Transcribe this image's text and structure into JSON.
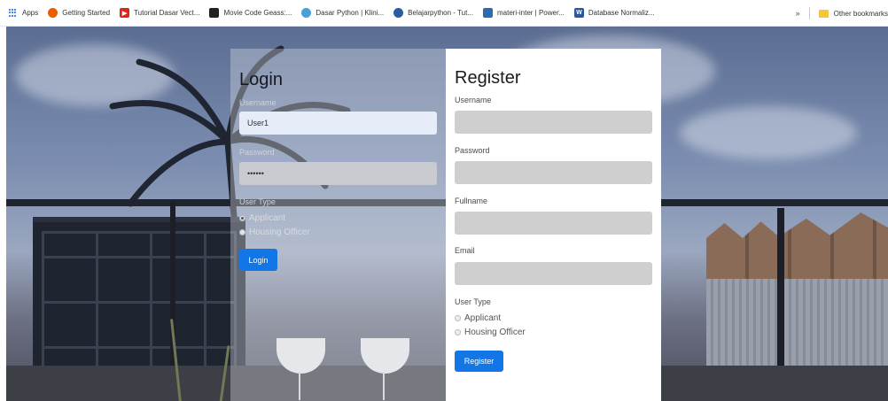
{
  "bookmarks": {
    "items": [
      {
        "label": "Apps",
        "icon": "apps-grid-icon",
        "color": "#4285f4"
      },
      {
        "label": "Getting Started",
        "icon": "firefox-icon",
        "color": "#e66000"
      },
      {
        "label": "Tutorial Dasar Vect...",
        "icon": "youtube-icon",
        "color": "#e62117"
      },
      {
        "label": "Movie Code Geass:...",
        "icon": "film-icon",
        "color": "#222222"
      },
      {
        "label": "Dasar Python | Klini...",
        "icon": "site-icon",
        "color": "#4aa0d8"
      },
      {
        "label": "Belajarpython - Tut...",
        "icon": "python-icon",
        "color": "#2a5d9f"
      },
      {
        "label": "materi-inter | Power...",
        "icon": "slides-icon",
        "color": "#2b6cb0"
      },
      {
        "label": "Database Normaliz...",
        "icon": "word-icon",
        "color": "#2b579a"
      }
    ],
    "overflow_label": "»",
    "other_label": "Other bookmarks"
  },
  "login": {
    "title": "Login",
    "username_label": "Username",
    "username_value": "User1",
    "password_label": "Password",
    "password_value": "••••••",
    "user_type_label": "User Type",
    "options": [
      "Applicant",
      "Housing Officer"
    ],
    "selected_option": "Applicant",
    "button_label": "Login"
  },
  "register": {
    "title": "Register",
    "username_label": "Username",
    "password_label": "Password",
    "fullname_label": "Fullname",
    "email_label": "Email",
    "user_type_label": "User Type",
    "options": [
      "Applicant",
      "Housing Officer"
    ],
    "button_label": "Register"
  },
  "colors": {
    "primary": "#1376e6",
    "register_bg": "#ffffff",
    "input_fill": "#cfcfcf"
  }
}
